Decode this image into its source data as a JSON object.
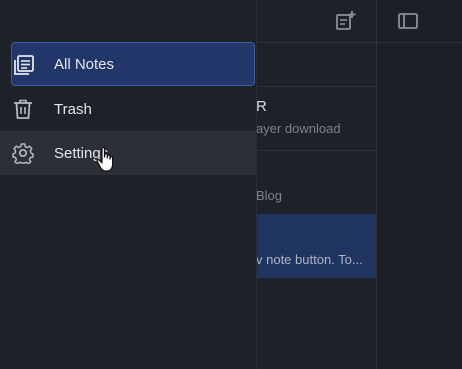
{
  "sidebar": {
    "items": [
      {
        "label": "All Notes",
        "icon": "all-notes-icon",
        "active": true
      },
      {
        "label": "Trash",
        "icon": "trash-icon",
        "active": false
      },
      {
        "label": "Settings",
        "icon": "settings-icon",
        "active": false
      }
    ]
  },
  "toolbar": {
    "new_note_icon": "new-note-icon",
    "toggle_icon": "sidebar-toggle-icon"
  },
  "notes": [
    {
      "title": "R",
      "subtitle": "ayer download"
    },
    {
      "title": "",
      "subtitle": "Blog"
    },
    {
      "title": "",
      "subtitle": "v note button. To..."
    }
  ],
  "colors": {
    "accent": "#22366a",
    "accent_border": "#3f5da0",
    "selected_note": "#1f3460",
    "background": "#1c2026"
  }
}
